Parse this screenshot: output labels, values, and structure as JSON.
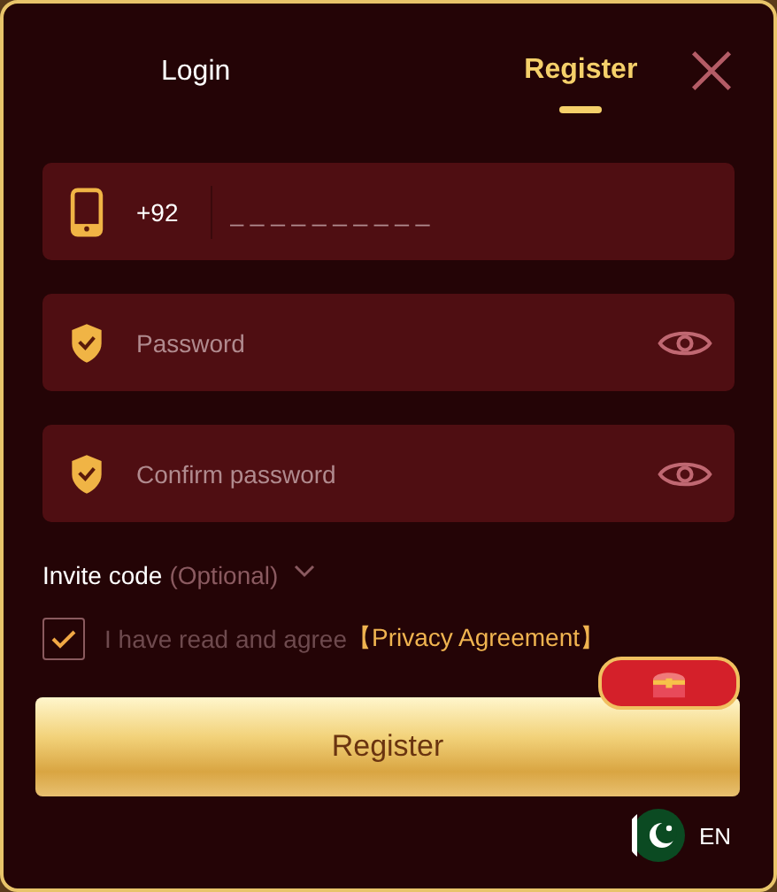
{
  "tabs": [
    {
      "label": "Login",
      "selected": false
    },
    {
      "label": "Register",
      "selected": true
    }
  ],
  "phone": {
    "country_code": "+92",
    "placeholder": "_ _ _ _ _ _ _ _ _ _"
  },
  "password_fields": [
    {
      "placeholder": "Password"
    },
    {
      "placeholder": "Confirm password"
    }
  ],
  "invite_code": {
    "label": "Invite code",
    "hint": "(Optional)",
    "expanded": false
  },
  "agreement": {
    "checked": true,
    "text": "I have read and agree",
    "link": "【Privacy Agreement】"
  },
  "submit": "Register",
  "language": "EN"
}
